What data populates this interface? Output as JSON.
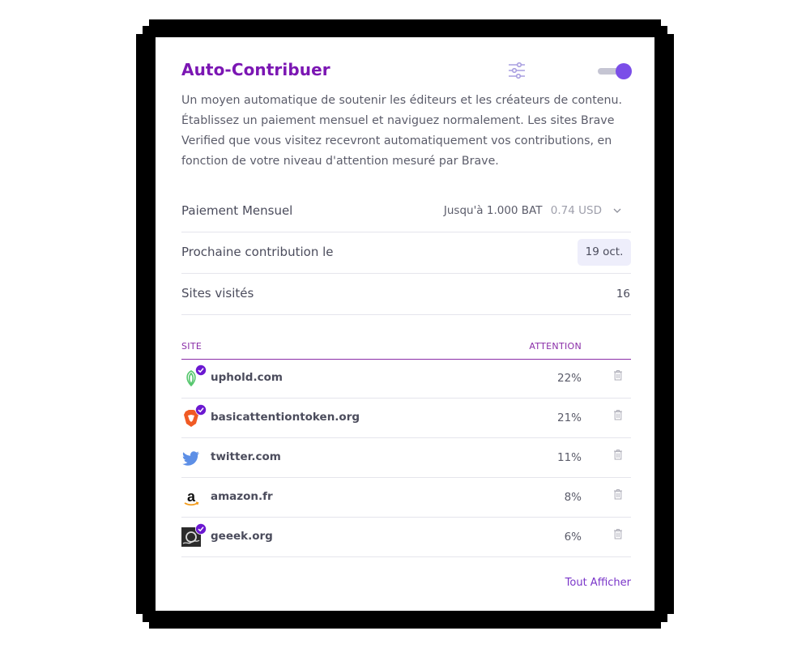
{
  "panel": {
    "title": "Auto-Contribuer",
    "settings_icon": "sliders-icon",
    "toggle_on": true,
    "description": "Un moyen automatique de soutenir les éditeurs et les créateurs de contenu. Établissez un paiement mensuel et naviguez normalement. Les sites Brave Verified que vous visitez recevront automatiquement vos contributions, en fonction de votre niveau d'attention mesuré par Brave."
  },
  "summary": {
    "monthly_label": "Paiement Mensuel",
    "monthly_prefix": "Jusqu'à",
    "monthly_bat": "1.000 BAT",
    "monthly_usd": "0.74 USD",
    "next_label": "Prochaine contribution le",
    "next_date": "19 oct.",
    "visited_label": "Sites visités",
    "visited_count": "16"
  },
  "table": {
    "col_site": "SITE",
    "col_attention": "ATTENTION",
    "rows": [
      {
        "name": "uphold.com",
        "attention": "22%",
        "verified": true,
        "icon": "uphold-icon"
      },
      {
        "name": "basicattentiontoken.org",
        "attention": "21%",
        "verified": true,
        "icon": "brave-lion-icon"
      },
      {
        "name": "twitter.com",
        "attention": "11%",
        "verified": false,
        "icon": "twitter-bird-icon"
      },
      {
        "name": "amazon.fr",
        "attention": "8%",
        "verified": false,
        "icon": "amazon-icon"
      },
      {
        "name": "geeek.org",
        "attention": "6%",
        "verified": true,
        "icon": "geeek-icon"
      }
    ]
  },
  "footer": {
    "show_all": "Tout Afficher"
  },
  "colors": {
    "accent": "#7b16b3",
    "toggle_knob": "#7b4ee8",
    "verified": "#6b18d1",
    "link": "#7a35c9"
  }
}
